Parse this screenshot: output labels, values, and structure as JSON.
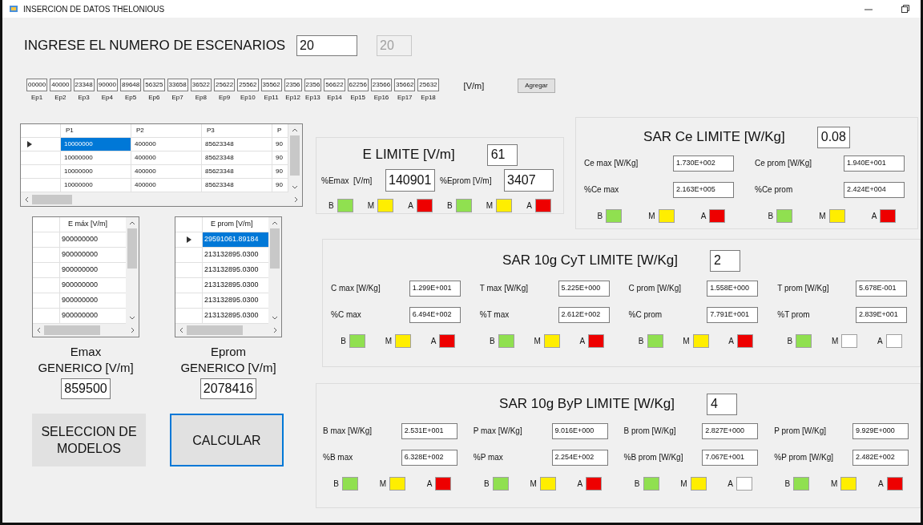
{
  "window": {
    "title": "INSERCION DE DATOS THELONIOUS"
  },
  "scenarios": {
    "label": "INGRESE EL NUMERO DE ESCENARIOS",
    "value": "20",
    "echo": {
      "value": "20",
      "disabled": true
    }
  },
  "ep_values": [
    {
      "label": "Ep1",
      "value": "00000"
    },
    {
      "label": "Ep2",
      "value": "40000"
    },
    {
      "label": "Ep3",
      "value": "23348"
    },
    {
      "label": "Ep4",
      "value": "90000"
    },
    {
      "label": "Ep5",
      "value": "89648"
    },
    {
      "label": "Ep6",
      "value": "56325"
    },
    {
      "label": "Ep7",
      "value": "33658"
    },
    {
      "label": "Ep8",
      "value": "36522"
    },
    {
      "label": "Ep9",
      "value": "25622"
    },
    {
      "label": "Ep10",
      "value": "25562"
    },
    {
      "label": "Ep11",
      "value": "35562"
    },
    {
      "label": "Ep12",
      "value": "2356"
    },
    {
      "label": "Ep13",
      "value": "2356"
    },
    {
      "label": "Ep14",
      "value": "56622"
    },
    {
      "label": "Ep15",
      "value": "62256"
    },
    {
      "label": "Ep16",
      "value": "23566"
    },
    {
      "label": "Ep17",
      "value": "35662"
    },
    {
      "label": "Ep18",
      "value": "25632"
    }
  ],
  "ep_unit": "[V/m]",
  "add_button": "Agregar",
  "main_grid": {
    "columns": [
      "P1",
      "P2",
      "P3",
      "P"
    ],
    "rows": [
      {
        "selected": true,
        "cells": [
          "10000000",
          "400000",
          "85623348",
          "90"
        ]
      },
      {
        "selected": false,
        "cells": [
          "10000000",
          "400000",
          "85623348",
          "90"
        ]
      },
      {
        "selected": false,
        "cells": [
          "10000000",
          "400000",
          "85623348",
          "90"
        ]
      },
      {
        "selected": false,
        "cells": [
          "10000000",
          "400000",
          "85623348",
          "90"
        ]
      }
    ]
  },
  "small_grids": [
    {
      "column": "E máx [V/m]",
      "rows": [
        {
          "selected": false,
          "value": "900000000"
        },
        {
          "selected": false,
          "value": "900000000"
        },
        {
          "selected": false,
          "value": "900000000"
        },
        {
          "selected": false,
          "value": "900000000"
        },
        {
          "selected": false,
          "value": "900000000"
        },
        {
          "selected": false,
          "value": "900000000"
        }
      ]
    },
    {
      "column": "E prom [V/m]",
      "rows": [
        {
          "selected": true,
          "value": "29591061.89184"
        },
        {
          "selected": false,
          "value": "213132895.0300"
        },
        {
          "selected": false,
          "value": "213132895.0300"
        },
        {
          "selected": false,
          "value": "213132895.0300"
        },
        {
          "selected": false,
          "value": "213132895.0300"
        },
        {
          "selected": false,
          "value": "213132895.0300"
        }
      ]
    }
  ],
  "generic": [
    {
      "label": "Emax\nGENERICO [V/m]",
      "value": "859500"
    },
    {
      "label": "Eprom\nGENERICO [V/m]",
      "value": "2078416"
    }
  ],
  "buttons": [
    {
      "label": "SELECCION DE MODELOS",
      "focused": false
    },
    {
      "label": "CALCULAR",
      "focused": true
    }
  ],
  "e_limit": {
    "title": "E LIMITE [V/m]",
    "limit": "61",
    "columns": [
      {
        "fields": [
          {
            "label": "%Emax  [V/m]",
            "value": "140901"
          }
        ],
        "lamps": [
          {
            "label": "B",
            "color": "#90e050"
          },
          {
            "label": "M",
            "color": "#ffee00"
          },
          {
            "label": "A",
            "color": "#ee0000"
          }
        ]
      },
      {
        "fields": [
          {
            "label": "%Eprom [V/m]",
            "value": "3407"
          }
        ],
        "lamps": [
          {
            "label": "B",
            "color": "#90e050"
          },
          {
            "label": "M",
            "color": "#ffee00"
          },
          {
            "label": "A",
            "color": "#ee0000"
          }
        ]
      }
    ]
  },
  "sar_ce": {
    "title": "SAR Ce LIMITE [W/Kg]",
    "limit": "0.08",
    "columns": [
      {
        "fields": [
          {
            "label": "Ce max [W/Kg]",
            "value": "1.730E+002"
          },
          {
            "label": "%Ce max",
            "value": "2.163E+005"
          }
        ],
        "lamps": [
          {
            "label": "B",
            "color": "#90e050"
          },
          {
            "label": "M",
            "color": "#ffee00"
          },
          {
            "label": "A",
            "color": "#ee0000"
          }
        ]
      },
      {
        "fields": [
          {
            "label": "Ce prom [W/Kg]",
            "value": "1.940E+001"
          },
          {
            "label": "%Ce prom",
            "value": "2.424E+004"
          }
        ],
        "lamps": [
          {
            "label": "B",
            "color": "#90e050"
          },
          {
            "label": "M",
            "color": "#ffee00"
          },
          {
            "label": "A",
            "color": "#ee0000"
          }
        ]
      }
    ]
  },
  "sar_cyt": {
    "title": "SAR 10g CyT LIMITE [W/Kg]",
    "limit": "2",
    "columns": [
      {
        "fields": [
          {
            "label": "C max [W/Kg]",
            "value": "1.299E+001"
          },
          {
            "label": "%C max",
            "value": "6.494E+002"
          }
        ],
        "lamps": [
          {
            "label": "B",
            "color": "#90e050"
          },
          {
            "label": "M",
            "color": "#ffee00"
          },
          {
            "label": "A",
            "color": "#ee0000"
          }
        ]
      },
      {
        "fields": [
          {
            "label": "T max [W/Kg]",
            "value": "5.225E+000"
          },
          {
            "label": "%T max",
            "value": "2.612E+002"
          }
        ],
        "lamps": [
          {
            "label": "B",
            "color": "#90e050"
          },
          {
            "label": "M",
            "color": "#ffee00"
          },
          {
            "label": "A",
            "color": "#ee0000"
          }
        ]
      },
      {
        "fields": [
          {
            "label": "C prom [W/Kg]",
            "value": "1.558E+000"
          },
          {
            "label": "%C prom",
            "value": "7.791E+001"
          }
        ],
        "lamps": [
          {
            "label": "B",
            "color": "#90e050"
          },
          {
            "label": "M",
            "color": "#ffee00"
          },
          {
            "label": "A",
            "color": "#ee0000"
          }
        ]
      },
      {
        "fields": [
          {
            "label": "T prom [W/Kg]",
            "value": "5.678E-001"
          },
          {
            "label": "%T prom",
            "value": "2.839E+001"
          }
        ],
        "lamps": [
          {
            "label": "B",
            "color": "#90e050"
          },
          {
            "label": "M",
            "color": "#ffffff"
          },
          {
            "label": "A",
            "color": "#ffffff"
          }
        ]
      }
    ]
  },
  "sar_byp": {
    "title": "SAR 10g ByP LIMITE [W/Kg]",
    "limit": "4",
    "columns": [
      {
        "fields": [
          {
            "label": "B max [W/Kg]",
            "value": "2.531E+001"
          },
          {
            "label": "%B max",
            "value": "6.328E+002"
          }
        ],
        "lamps": [
          {
            "label": "B",
            "color": "#90e050"
          },
          {
            "label": "M",
            "color": "#ffee00"
          },
          {
            "label": "A",
            "color": "#ee0000"
          }
        ]
      },
      {
        "fields": [
          {
            "label": "P max [W/Kg]",
            "value": "9.016E+000"
          },
          {
            "label": "%P max",
            "value": "2.254E+002"
          }
        ],
        "lamps": [
          {
            "label": "B",
            "color": "#90e050"
          },
          {
            "label": "M",
            "color": "#ffee00"
          },
          {
            "label": "A",
            "color": "#ee0000"
          }
        ]
      },
      {
        "fields": [
          {
            "label": "B prom [W/Kg]",
            "value": "2.827E+000"
          },
          {
            "label": "%B prom [W/Kg]",
            "value": "7.067E+001"
          }
        ],
        "lamps": [
          {
            "label": "B",
            "color": "#90e050"
          },
          {
            "label": "M",
            "color": "#ffee00"
          },
          {
            "label": "A",
            "color": "#ffffff"
          }
        ]
      },
      {
        "fields": [
          {
            "label": "P prom [W/Kg]",
            "value": "9.929E+000"
          },
          {
            "label": "%P prom [W/Kg]",
            "value": "2.482E+002"
          }
        ],
        "lamps": [
          {
            "label": "B",
            "color": "#90e050"
          },
          {
            "label": "M",
            "color": "#ffee00"
          },
          {
            "label": "A",
            "color": "#ee0000"
          }
        ]
      }
    ]
  }
}
